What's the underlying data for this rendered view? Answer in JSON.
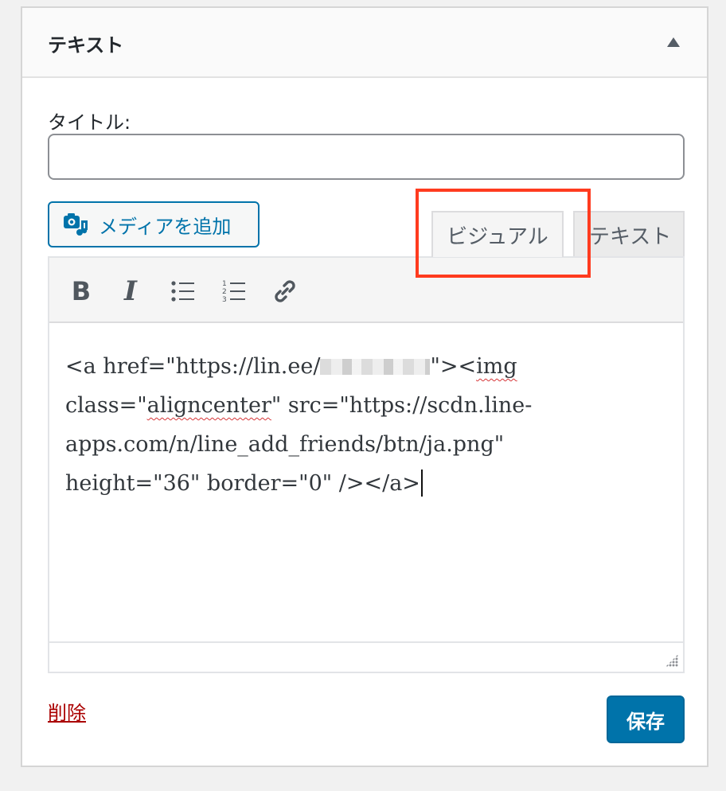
{
  "widget": {
    "title": "テキスト"
  },
  "form": {
    "title_label": "タイトル:",
    "title_value": ""
  },
  "media_button": {
    "label": "メディアを追加"
  },
  "tabs": {
    "visual": "ビジュアル",
    "text": "テキスト"
  },
  "toolbar": {
    "bold_label": "B",
    "italic_label": "I"
  },
  "content": {
    "line1_a": "<a href=\"https://lin.ee/",
    "line1_b": "\"><",
    "line1_img": "img",
    "line2_a": "class=\"",
    "line2_spell": "aligncenter",
    "line2_b": "\" src=\"https://scdn.line-",
    "line3": "apps.com/n/line_add_friends/btn/ja.png\"",
    "line4": "height=\"36\" border=\"0\" /></a>"
  },
  "actions": {
    "delete_label": "削除",
    "save_label": "保存"
  },
  "colors": {
    "accent": "#0073aa",
    "delete": "#aa0000",
    "highlight": "#ff3b1f"
  }
}
